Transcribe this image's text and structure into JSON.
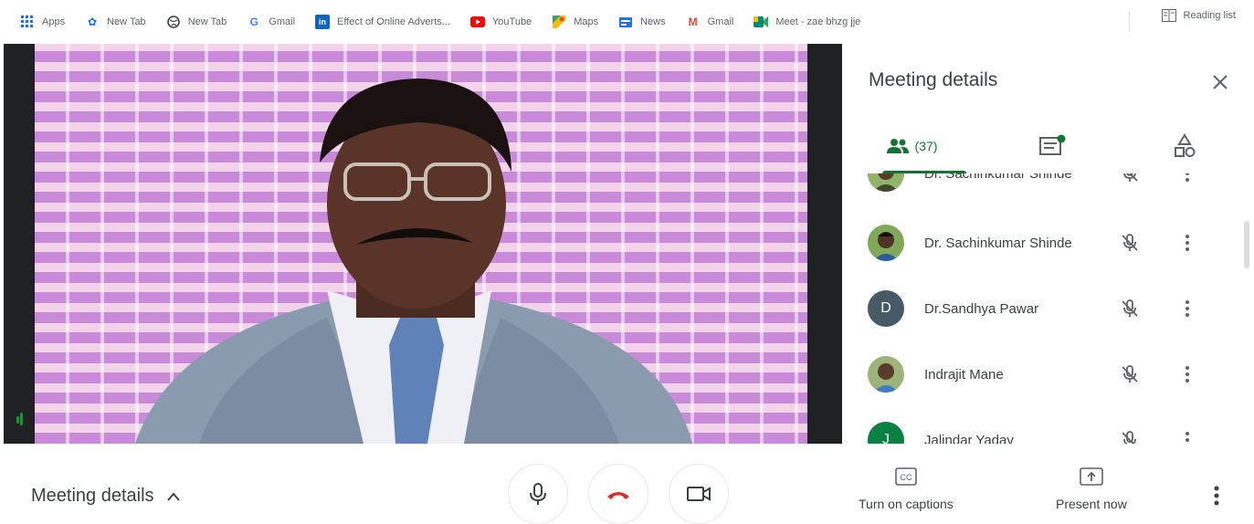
{
  "bookmarks": [
    {
      "label": "Apps",
      "icon": "apps-grid-icon",
      "color": "#1a73e8"
    },
    {
      "label": "New Tab",
      "icon": "settings-gear-icon",
      "color": "#1a73e8"
    },
    {
      "label": "New Tab",
      "icon": "globe-icon",
      "color": "#3c4043"
    },
    {
      "label": "Gmail",
      "icon": "google-g-icon",
      "color": "#4285f4"
    },
    {
      "label": "Effect of Online Adverts...",
      "icon": "linkedin-icon",
      "color": "#0a66c2"
    },
    {
      "label": "YouTube",
      "icon": "youtube-icon",
      "color": "#ff0000"
    },
    {
      "label": "Maps",
      "icon": "maps-icon",
      "color": "#34a853"
    },
    {
      "label": "News",
      "icon": "news-icon",
      "color": "#1a73e8"
    },
    {
      "label": "Gmail",
      "icon": "gmail-m-icon",
      "color": "#ea4335"
    },
    {
      "label": "Meet - zae bhzg jje",
      "icon": "meet-icon",
      "color": "#00897b"
    }
  ],
  "reading_list": "Reading list",
  "panel": {
    "title": "Meeting details",
    "people_count": "(37)",
    "participants": [
      {
        "name": "Dr. Sachinkumar Shinde",
        "avatar_type": "photo",
        "avatar_color": "#6a8f3c",
        "muted": true
      },
      {
        "name": "Dr. Sachinkumar Shinde",
        "avatar_type": "photo",
        "avatar_color": "#5b7d3a",
        "muted": true
      },
      {
        "name": "Dr.Sandhya Pawar",
        "avatar_type": "initial",
        "initial": "D",
        "avatar_color": "#455a64",
        "muted": true
      },
      {
        "name": "Indrajit Mane",
        "avatar_type": "photo",
        "avatar_color": "#7a9a5a",
        "muted": true
      },
      {
        "name": "Jalindar Yadav",
        "avatar_type": "initial",
        "initial": "J",
        "avatar_color": "#0b8043",
        "muted": true
      }
    ]
  },
  "bottom": {
    "meeting_details": "Meeting details",
    "captions_label": "Turn on captions",
    "present_label": "Present now"
  },
  "colors": {
    "accent_green": "#137333",
    "hangup_red": "#d93025"
  }
}
